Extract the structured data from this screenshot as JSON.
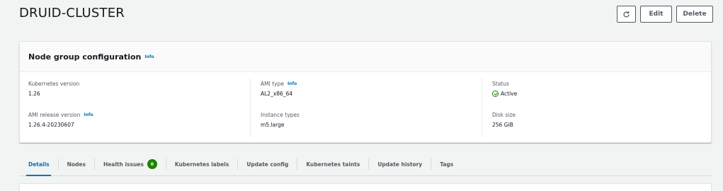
{
  "page": {
    "title": "DRUID-CLUSTER"
  },
  "actions": {
    "refresh_icon": "refresh-icon",
    "edit_label": "Edit",
    "delete_label": "Delete"
  },
  "card": {
    "title": "Node group configuration",
    "info": "Info",
    "fields": {
      "k8s_version": {
        "label": "Kubernetes version",
        "value": "1.26"
      },
      "ami_release": {
        "label": "AMI release version",
        "info": "Info",
        "value": "1.26.4-20230607"
      },
      "ami_type": {
        "label": "AMI type",
        "info": "Info",
        "value": "AL2_x86_64"
      },
      "instance_types": {
        "label": "Instance types",
        "value": "m5.large"
      },
      "status": {
        "label": "Status",
        "value": "Active",
        "color": "#1d8102"
      },
      "disk_size": {
        "label": "Disk size",
        "value": "256 GiB"
      }
    }
  },
  "tabs": [
    {
      "label": "Details",
      "active": true
    },
    {
      "label": "Nodes"
    },
    {
      "label": "Health issues",
      "badge": "0"
    },
    {
      "label": "Kubernetes labels"
    },
    {
      "label": "Update config"
    },
    {
      "label": "Kubernetes taints"
    },
    {
      "label": "Update history"
    },
    {
      "label": "Tags"
    }
  ],
  "colors": {
    "accent": "#0073bb",
    "success": "#1d8102",
    "background": "#f2f3f3"
  }
}
